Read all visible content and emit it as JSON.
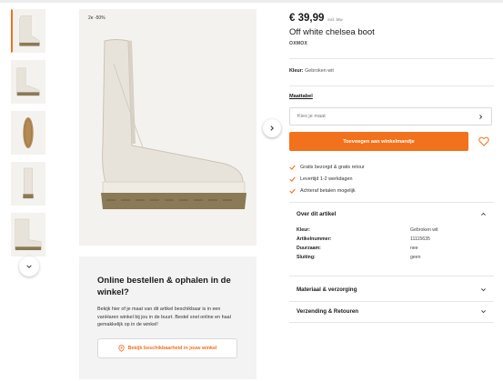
{
  "gallery": {
    "badge": "2e -50%",
    "thumb_count": 5
  },
  "pickup": {
    "title": "Online bestellen & ophalen in de winkel?",
    "text": "Bekijk hier of je maat van dit artikel beschikbaar is in een vanHaren winkel bij jou in de buurt. Bestel snel online en haal gemakkelijk op in de winkel!",
    "button_label": "Bekijk beschikbaarheid in jouw winkel",
    "button_icon": "location-pin-icon"
  },
  "product": {
    "price": "€ 39,99",
    "vat_note": "incl. btw",
    "title": "Off white chelsea boot",
    "brand": "OXMOX",
    "color_label": "Kleur:",
    "color_value": "Gebroken wit"
  },
  "size": {
    "label": "Maattabel",
    "placeholder": "Kies je maat"
  },
  "actions": {
    "add_to_cart": "Toevoegen aan winkelmandje",
    "wishlist_icon": "heart-icon"
  },
  "usps": [
    "Gratis bezorgd & gratis retour",
    "Levertijd 1-2 werkdagen",
    "Achteraf betalen mogelijk"
  ],
  "details": {
    "title": "Over dit artikel",
    "rows": [
      {
        "key": "Kleur:",
        "value": "Gebroken wit"
      },
      {
        "key": "Artikelnummer:",
        "value": "11115635"
      },
      {
        "key": "Duurzaam:",
        "value": "nee"
      },
      {
        "key": "Sluiting:",
        "value": "geen"
      }
    ]
  },
  "accordions": [
    "Materiaal & verzorging",
    "Verzending & Retouren"
  ],
  "colors": {
    "accent": "#f2711c",
    "boot_body": "#e8e3da",
    "boot_sole": "#8a7a55"
  }
}
